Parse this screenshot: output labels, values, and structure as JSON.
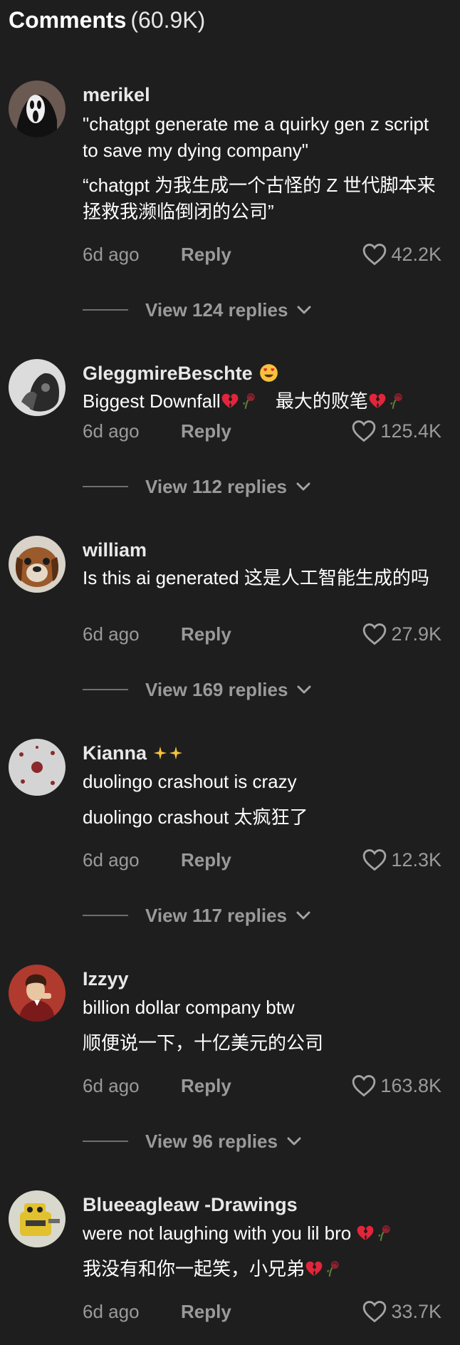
{
  "header": {
    "title": "Comments",
    "count": "(60.9K)"
  },
  "comments": [
    {
      "author": "merikel",
      "author_emoji": "",
      "lines": [
        "\"chatgpt generate me a quirky gen z script to save my dying company\"",
        "“chatgpt 为我生成一个古怪的 Z 世代脚本来拯救我濒临倒闭的公司”"
      ],
      "time": "6d ago",
      "reply": "Reply",
      "likes": "42.2K",
      "view_replies": "View 124 replies"
    },
    {
      "author": "GleggmireBeschte",
      "author_emoji": "heart-eyes-emoji",
      "lines": [
        "Biggest Downfall",
        "最大的败笔"
      ],
      "time": "6d ago",
      "reply": "Reply",
      "likes": "125.4K",
      "view_replies": "View 112 replies"
    },
    {
      "author": "william",
      "author_emoji": "",
      "lines": [
        "Is this ai generated  这是人工智能生成的吗"
      ],
      "time": "6d ago",
      "reply": "Reply",
      "likes": "27.9K",
      "view_replies": "View 169 replies"
    },
    {
      "author": "Kianna",
      "author_emoji": "sparkles-emoji",
      "lines": [
        "duolingo crashout is crazy",
        "duolingo crashout 太疯狂了"
      ],
      "time": "6d ago",
      "reply": "Reply",
      "likes": "12.3K",
      "view_replies": "View 117 replies"
    },
    {
      "author": "Izzyy",
      "author_emoji": "",
      "lines": [
        "billion dollar company btw",
        "顺便说一下，十亿美元的公司"
      ],
      "time": "6d ago",
      "reply": "Reply",
      "likes": "163.8K",
      "view_replies": "View 96 replies"
    },
    {
      "author": "Blueeagleaw -Drawings",
      "author_emoji": "",
      "lines": [
        "were not laughing with you lil bro",
        "我没有和你一起笑，小兄弟"
      ],
      "time": "6d ago",
      "reply": "Reply",
      "likes": "33.7K",
      "view_replies": ""
    }
  ]
}
